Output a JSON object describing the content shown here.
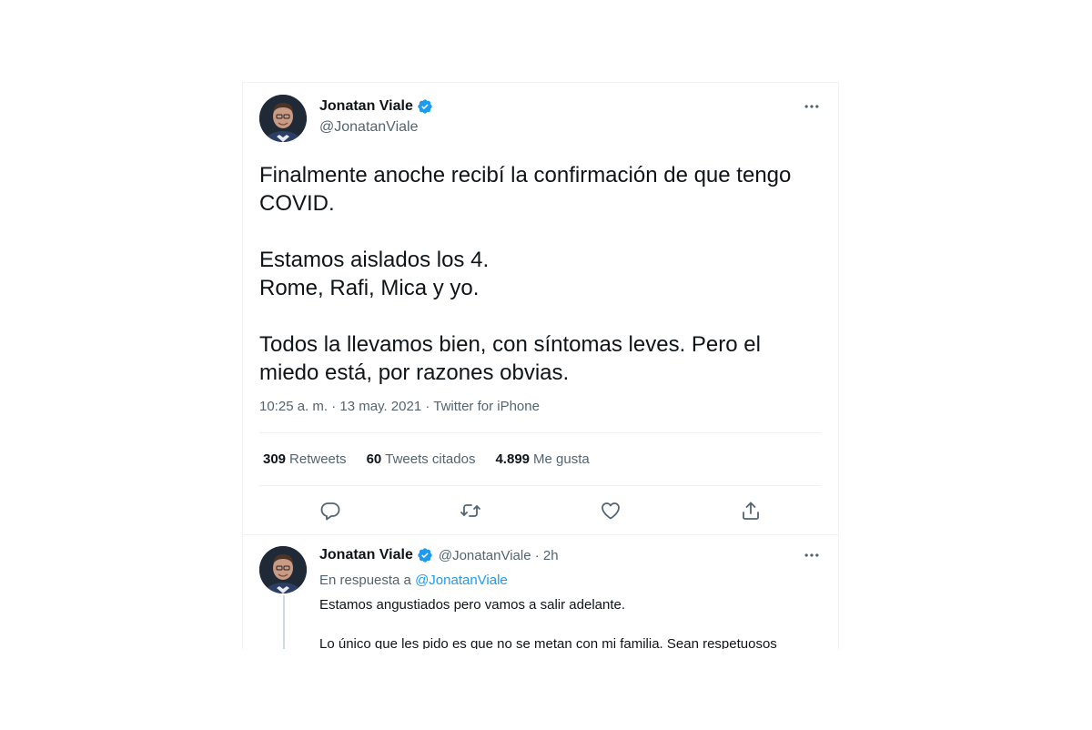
{
  "main_tweet": {
    "display_name": "Jonatan Viale",
    "handle": "@JonatanViale",
    "body": "Finalmente anoche recibí la confirmación de que tengo\nCOVID.\n\nEstamos aislados los 4.\nRome, Rafi, Mica y yo.\n\nTodos la llevamos bien, con síntomas leves. Pero el\nmiedo está, por razones obvias.",
    "time": "10:25 a. m.",
    "date": "13 may. 2021",
    "source": "Twitter for iPhone",
    "separator": " · ",
    "retweets_count": "309",
    "retweets_label": "Retweets",
    "quotes_count": "60",
    "quotes_label": "Tweets citados",
    "likes_count": "4.899",
    "likes_label": "Me gusta"
  },
  "reply_tweet": {
    "display_name": "Jonatan Viale",
    "handle_time": "@JonatanViale · 2h",
    "replying_prefix": "En respuesta a",
    "replying_to": "@JonatanViale",
    "line1": "Estamos angustiados pero vamos a salir adelante.",
    "line2": "Lo único que les pido es que no se metan con mi familia. Sean respetuosos"
  },
  "icons": {
    "verified": "verified-badge-icon",
    "more": "more-horizontal-icon",
    "reply": "reply-icon",
    "retweet": "retweet-icon",
    "like": "heart-icon",
    "share": "share-icon"
  },
  "colors": {
    "accent": "#1d9bf0",
    "text": "#0f1419",
    "secondary": "#536471",
    "border": "#eff3f4"
  }
}
